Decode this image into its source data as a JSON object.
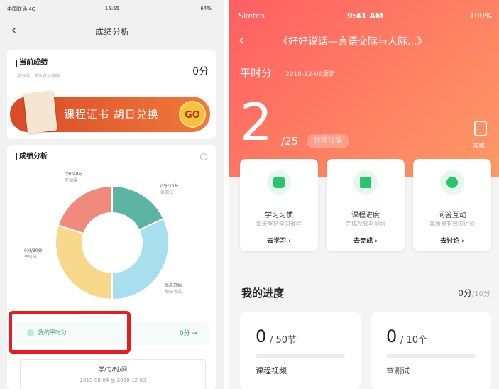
{
  "left": {
    "status": {
      "carrier": "中国联通 4G",
      "time": "15:55",
      "battery": "64%"
    },
    "nav": {
      "title": "成绩分析"
    },
    "current": {
      "title": "当前成绩",
      "sub": "学分课，请认真对待哦",
      "score": "0分"
    },
    "banner": {
      "text": "课程证书 胡日兑换",
      "go": "GO"
    },
    "analysis": {
      "title": "成绩分析",
      "ann1": {
        "v": "0分/40分",
        "l": "互动课"
      },
      "ann2": {
        "v": "0分/30分",
        "l": "章测试"
      },
      "ann3": {
        "v": "0分/30分",
        "l": "平时分"
      },
      "ann4": {
        "v": "尚未开始",
        "l": "期末考试"
      }
    },
    "mine": {
      "label": "我的平时分",
      "score": "0分 →"
    },
    "period": {
      "title": "学/习/时/间",
      "range": "2019-08-04 至 2020-12-03"
    }
  },
  "right": {
    "status": {
      "carrier": "Sketch",
      "time": "9:41 AM",
      "battery": "100%"
    },
    "nav": {
      "title": "《好好说话—言语交际与人际...》"
    },
    "hero": {
      "label": "平时分",
      "date": "2018-12-06更新",
      "score": "2",
      "total": "/25",
      "cheer": "继续加油",
      "strategy": "攻略"
    },
    "features": [
      {
        "title": "学习习惯",
        "desc": "每天坚持学习课程",
        "action": "去学习 ›"
      },
      {
        "title": "课程进度",
        "desc": "完成视频与测验",
        "action": "去完成 ›"
      },
      {
        "title": "问答互动",
        "desc": "高质量有效的讨论",
        "action": "去讨论 ›"
      }
    ],
    "progress": {
      "title": "我的进度",
      "score": "0分",
      "max": "/10分",
      "cards": [
        {
          "value": "0",
          "unit": "/ 50节",
          "label": "课程视频"
        },
        {
          "value": "0",
          "unit": "/ 10个",
          "label": "章测试"
        }
      ]
    }
  },
  "colors": {
    "hero_start": "#ff5e62",
    "hero_end": "#ff9966",
    "accent_green": "#29c46c",
    "highlight_red": "#e81c1c"
  },
  "chart_data": {
    "type": "pie",
    "values": [
      18,
      32,
      30,
      20
    ],
    "colors": [
      "#5bb5a2",
      "#a7dfee",
      "#f8d98c",
      "#f08a7c"
    ]
  }
}
